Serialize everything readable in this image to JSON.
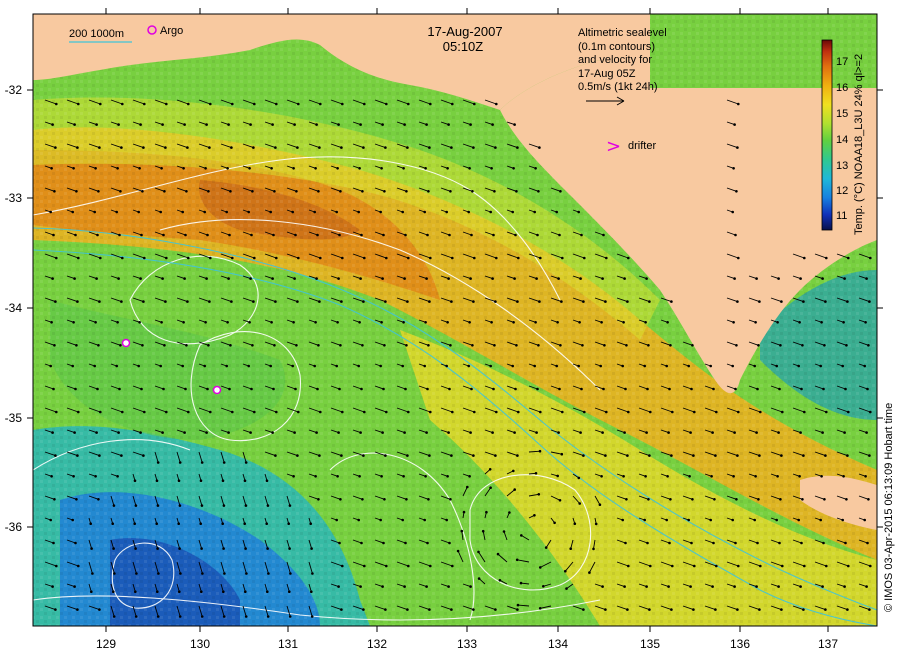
{
  "map": {
    "date": "17-Aug-2007",
    "time": "05:10Z",
    "land_color": "#f8c9a0",
    "contour_color": "#ffffff",
    "isobath_color": "#40c4d8"
  },
  "legend": {
    "scale_bar": "200  1000m",
    "argo": "Argo",
    "altimetry_lines": [
      "Altimetric sealevel",
      "(0.1m contours)",
      "and velocity for",
      "17-Aug 05Z",
      "0.5m/s (1kt 24h)"
    ],
    "drifter_symbol": ">",
    "drifter": "drifter"
  },
  "colorbar": {
    "label": "Temp. (°C) NOAA18_L3U 24% ql>=2",
    "ticks": [
      "11",
      "12",
      "13",
      "14",
      "15",
      "16",
      "17"
    ],
    "colors": [
      "#08104a",
      "#1030b8",
      "#1880e0",
      "#20b8d8",
      "#30c890",
      "#60d040",
      "#b0e030",
      "#f0e020",
      "#f0b010",
      "#e07010",
      "#c03010",
      "#6a0808"
    ]
  },
  "axes": {
    "x_ticks": [
      "129",
      "130",
      "131",
      "132",
      "133",
      "134",
      "135",
      "136",
      "137"
    ],
    "y_ticks": [
      "-32",
      "-33",
      "-34",
      "-35",
      "-36"
    ]
  },
  "credit": "© IMOS 03-Apr-2015 06:13:09 Hobart time"
}
